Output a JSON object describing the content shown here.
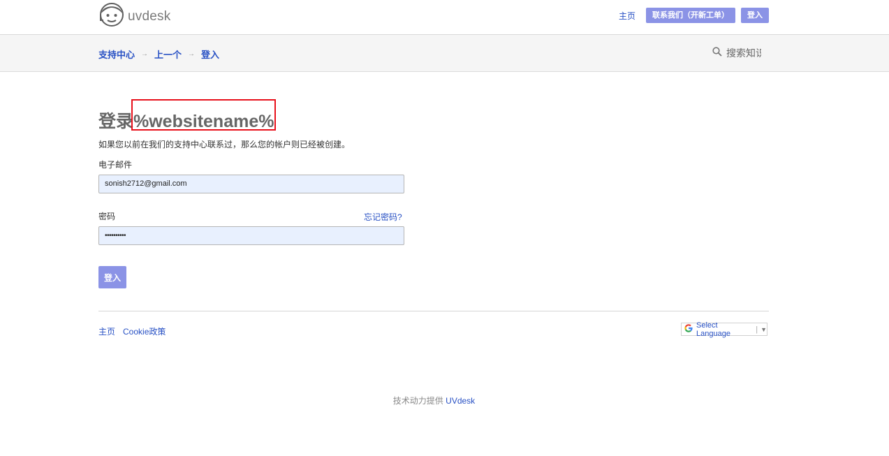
{
  "header": {
    "logo_text": "uvdesk",
    "nav_home": "主页",
    "contact_button": "联系我们（开新工单）",
    "login_button": "登入"
  },
  "breadcrumb": {
    "items": [
      "支持中心",
      "上一个",
      "登入"
    ]
  },
  "search": {
    "placeholder": "搜索知识"
  },
  "form": {
    "title": "登录%websitename%",
    "intro": "如果您以前在我们的支持中心联系过，那么您的帐户则已经被创建。",
    "email_label": "电子邮件",
    "email_value": "sonish2712@gmail.com",
    "password_label": "密码",
    "password_value": "••••••••••",
    "forgot_link": "忘记密码?",
    "submit_label": "登入"
  },
  "footer": {
    "links": [
      "主页",
      "Cookie政策"
    ],
    "language_select": "Select Language",
    "powered_by_text": "技术动力提供",
    "powered_by_link": "UVdesk"
  },
  "colors": {
    "accent": "#8b93e6",
    "link": "#2750c4",
    "highlight": "#e8101b"
  }
}
